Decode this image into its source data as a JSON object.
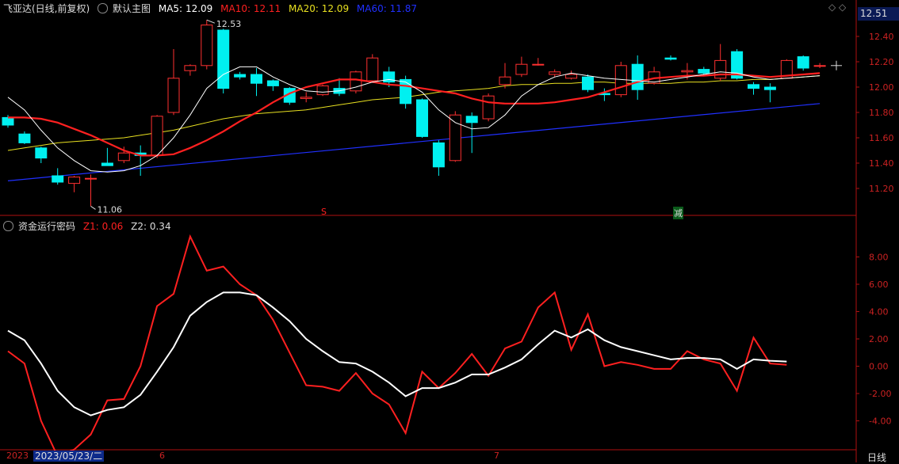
{
  "top": {
    "stock_name": "飞亚达(日线,前复权)",
    "template": "默认主图",
    "ma": [
      {
        "label": "MA5:",
        "value": "12.09",
        "color": "#ffffff"
      },
      {
        "label": "MA10:",
        "value": "12.11",
        "color": "#ff2020"
      },
      {
        "label": "MA20:",
        "value": "12.09",
        "color": "#e8e020"
      },
      {
        "label": "MA60:",
        "value": "11.87",
        "color": "#2030ff"
      }
    ],
    "current_price": "12.51",
    "high_label": "12.53",
    "low_label": "11.06",
    "marker_s": "S",
    "marker_jian": "减"
  },
  "bottom": {
    "indicator": "资金运行密码",
    "z1_label": "Z1:",
    "z1_value": "0.06",
    "z2_label": "Z2:",
    "z2_value": "0.34"
  },
  "footer": {
    "date_left": "2023",
    "date_cursor": "2023/05/23/二",
    "month_6": "6",
    "month_7": "7",
    "period": "日线"
  },
  "chart_data": [
    {
      "type": "candlestick",
      "title": "飞亚达(日线,前复权)",
      "ylim": [
        11.0,
        12.55
      ],
      "yticks": [
        11.2,
        11.4,
        11.6,
        11.8,
        12.0,
        12.2,
        12.4
      ],
      "candles_ohlc": [
        [
          11.76,
          11.78,
          11.68,
          11.7
        ],
        [
          11.63,
          11.65,
          11.55,
          11.56
        ],
        [
          11.52,
          11.53,
          11.4,
          11.44
        ],
        [
          11.3,
          11.36,
          11.23,
          11.25
        ],
        [
          11.24,
          11.3,
          11.17,
          11.29
        ],
        [
          11.28,
          11.31,
          11.06,
          11.28
        ],
        [
          11.4,
          11.52,
          11.38,
          11.38
        ],
        [
          11.42,
          11.53,
          11.4,
          11.48
        ],
        [
          11.48,
          11.54,
          11.3,
          11.46
        ],
        [
          11.46,
          11.78,
          11.44,
          11.77
        ],
        [
          11.8,
          12.3,
          11.78,
          12.07
        ],
        [
          12.13,
          12.18,
          12.09,
          12.17
        ],
        [
          12.17,
          12.53,
          12.14,
          12.49
        ],
        [
          12.45,
          12.46,
          11.95,
          11.99
        ],
        [
          12.1,
          12.12,
          12.06,
          12.08
        ],
        [
          12.1,
          12.15,
          11.93,
          12.03
        ],
        [
          12.05,
          12.06,
          11.97,
          12.01
        ],
        [
          11.99,
          12.0,
          11.86,
          11.88
        ],
        [
          11.91,
          11.96,
          11.88,
          11.92
        ],
        [
          11.94,
          12.02,
          11.93,
          12.01
        ],
        [
          11.99,
          12.07,
          11.93,
          11.95
        ],
        [
          11.97,
          12.13,
          11.95,
          12.12
        ],
        [
          12.05,
          12.26,
          12.04,
          12.23
        ],
        [
          12.12,
          12.16,
          12.0,
          12.04
        ],
        [
          12.06,
          12.09,
          11.83,
          11.87
        ],
        [
          11.9,
          11.91,
          11.6,
          11.61
        ],
        [
          11.56,
          11.58,
          11.3,
          11.37
        ],
        [
          11.42,
          11.81,
          11.41,
          11.78
        ],
        [
          11.77,
          11.8,
          11.48,
          11.72
        ],
        [
          11.75,
          11.95,
          11.73,
          11.93
        ],
        [
          12.02,
          12.19,
          11.99,
          12.08
        ],
        [
          12.1,
          12.24,
          12.08,
          12.18
        ],
        [
          12.18,
          12.23,
          12.17,
          12.18
        ],
        [
          12.1,
          12.14,
          12.08,
          12.12
        ],
        [
          12.07,
          12.13,
          12.06,
          12.1
        ],
        [
          12.08,
          12.1,
          11.96,
          11.98
        ],
        [
          11.95,
          11.99,
          11.89,
          11.94
        ],
        [
          11.94,
          12.2,
          11.92,
          12.17
        ],
        [
          12.18,
          12.25,
          11.9,
          11.98
        ],
        [
          12.03,
          12.16,
          12.02,
          12.12
        ],
        [
          12.23,
          12.25,
          12.21,
          12.22
        ],
        [
          12.12,
          12.19,
          12.06,
          12.13
        ],
        [
          12.14,
          12.16,
          12.1,
          12.11
        ],
        [
          12.07,
          12.34,
          12.05,
          12.21
        ],
        [
          12.28,
          12.3,
          12.06,
          12.07
        ],
        [
          12.02,
          12.04,
          11.94,
          11.99
        ],
        [
          12.0,
          12.03,
          11.88,
          11.98
        ],
        [
          12.07,
          12.22,
          12.07,
          12.21
        ],
        [
          12.24,
          12.25,
          12.13,
          12.15
        ],
        [
          12.17,
          12.19,
          12.15,
          12.17
        ]
      ],
      "ma5": [
        11.92,
        11.82,
        11.66,
        11.52,
        11.42,
        11.34,
        11.33,
        11.34,
        11.38,
        11.46,
        11.6,
        11.78,
        11.99,
        12.1,
        12.16,
        12.16,
        12.08,
        12.02,
        11.97,
        11.96,
        11.97,
        12.0,
        12.04,
        12.06,
        12.04,
        11.96,
        11.82,
        11.72,
        11.67,
        11.68,
        11.78,
        11.93,
        12.02,
        12.08,
        12.11,
        12.09,
        12.07,
        12.06,
        12.05,
        12.04,
        12.06,
        12.08,
        12.1,
        12.12,
        12.11,
        12.08,
        12.06,
        12.07,
        12.08,
        12.09
      ],
      "ma10": [
        11.76,
        11.76,
        11.75,
        11.72,
        11.67,
        11.62,
        11.56,
        11.5,
        11.46,
        11.46,
        11.47,
        11.52,
        11.58,
        11.65,
        11.73,
        11.8,
        11.88,
        11.95,
        12.0,
        12.03,
        12.06,
        12.06,
        12.04,
        12.02,
        12.01,
        11.99,
        11.97,
        11.95,
        11.91,
        11.88,
        11.87,
        11.87,
        11.87,
        11.88,
        11.9,
        11.92,
        11.96,
        12.0,
        12.04,
        12.07,
        12.08,
        12.09,
        12.09,
        12.1,
        12.1,
        12.09,
        12.08,
        12.09,
        12.1,
        12.11
      ],
      "ma20": [
        11.5,
        11.52,
        11.54,
        11.56,
        11.57,
        11.58,
        11.59,
        11.6,
        11.62,
        11.64,
        11.66,
        11.69,
        11.72,
        11.75,
        11.77,
        11.79,
        11.8,
        11.81,
        11.82,
        11.84,
        11.86,
        11.88,
        11.9,
        11.91,
        11.92,
        11.94,
        11.96,
        11.97,
        11.98,
        11.99,
        12.01,
        12.02,
        12.02,
        12.03,
        12.03,
        12.04,
        12.04,
        12.03,
        12.03,
        12.03,
        12.03,
        12.04,
        12.04,
        12.05,
        12.05,
        12.06,
        12.06,
        12.07,
        12.08,
        12.09
      ],
      "ma60_start": 11.26,
      "ma60_end": 11.87
    },
    {
      "type": "line",
      "title": "资金运行密码",
      "ylim": [
        -6.0,
        10.0
      ],
      "yticks": [
        -4.0,
        -2.0,
        0.0,
        2.0,
        4.0,
        6.0,
        8.0
      ],
      "series": [
        {
          "name": "Z1",
          "color": "#ff2020",
          "values": [
            1.1,
            0.2,
            -4.0,
            -6.6,
            -6.1,
            -5.0,
            -2.5,
            -2.4,
            0.0,
            4.4,
            5.3,
            9.5,
            7.0,
            7.3,
            6.0,
            5.2,
            3.4,
            1.0,
            -1.4,
            -1.5,
            -1.8,
            -0.5,
            -2.0,
            -2.8,
            -4.9,
            -0.4,
            -1.6,
            -0.5,
            0.9,
            -0.7,
            1.3,
            1.8,
            4.3,
            5.4,
            1.2,
            3.8,
            0.0,
            0.3,
            0.1,
            -0.2,
            -0.2,
            1.1,
            0.5,
            0.2,
            -1.8,
            2.1,
            0.2,
            0.1
          ]
        },
        {
          "name": "Z2",
          "color": "#ffffff",
          "values": [
            2.6,
            1.9,
            0.2,
            -1.8,
            -3.0,
            -3.6,
            -3.2,
            -3.0,
            -2.1,
            -0.4,
            1.4,
            3.7,
            4.7,
            5.4,
            5.4,
            5.2,
            4.3,
            3.3,
            2.0,
            1.1,
            0.3,
            0.2,
            -0.4,
            -1.2,
            -2.2,
            -1.6,
            -1.6,
            -1.2,
            -0.6,
            -0.6,
            -0.1,
            0.5,
            1.6,
            2.6,
            2.1,
            2.7,
            1.9,
            1.4,
            1.1,
            0.8,
            0.5,
            0.6,
            0.6,
            0.5,
            -0.2,
            0.5,
            0.4,
            0.34
          ]
        }
      ]
    }
  ]
}
